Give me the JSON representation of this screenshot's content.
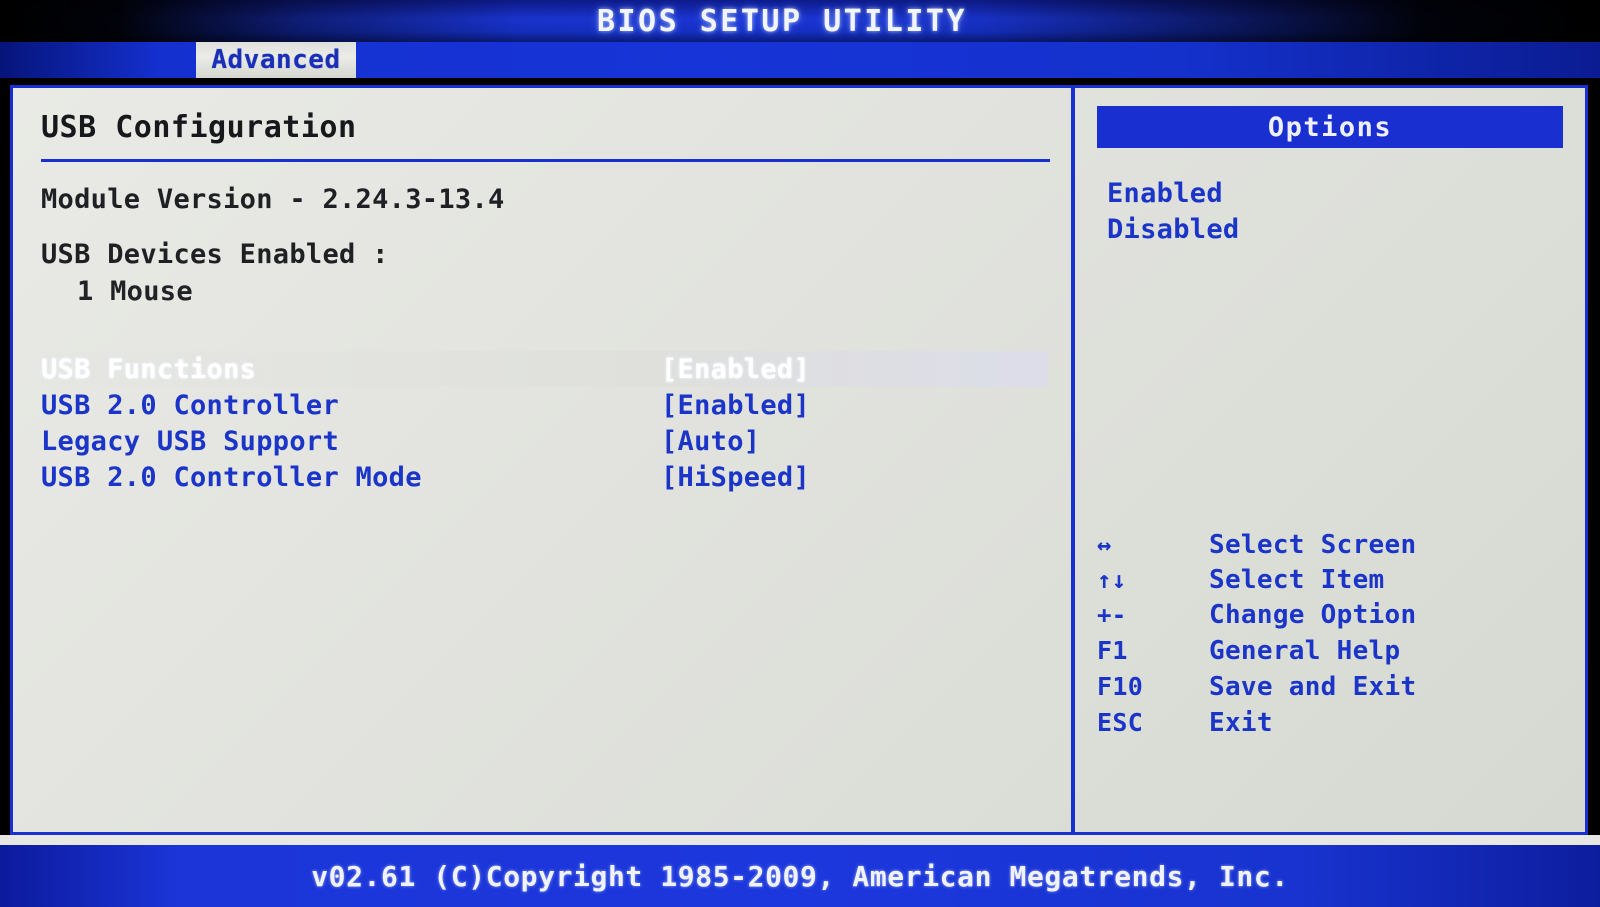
{
  "titlebar": {
    "title": "BIOS SETUP UTILITY"
  },
  "menubar": {
    "tabs": [
      {
        "label": "Advanced",
        "selected": true
      }
    ]
  },
  "main": {
    "section_title": "USB Configuration",
    "module_version_line": "Module Version - 2.24.3-13.4",
    "devices_header": "USB Devices Enabled :",
    "devices": [
      "1 Mouse"
    ],
    "settings": [
      {
        "label": "USB Functions",
        "value": "[Enabled]",
        "selected": true
      },
      {
        "label": "USB 2.0 Controller",
        "value": "[Enabled]",
        "selected": false
      },
      {
        "label": "Legacy USB Support",
        "value": "[Auto]",
        "selected": false
      },
      {
        "label": "USB 2.0 Controller Mode",
        "value": "[HiSpeed]",
        "selected": false
      }
    ]
  },
  "options_panel": {
    "header": "Options",
    "items": [
      "Enabled",
      "Disabled"
    ]
  },
  "legend": {
    "rows": [
      {
        "key": "↔",
        "desc": "Select Screen"
      },
      {
        "key": "↑↓",
        "desc": "Select Item"
      },
      {
        "key": "+-",
        "desc": "Change Option"
      },
      {
        "key": "F1",
        "desc": "General Help"
      },
      {
        "key": "F10",
        "desc": "Save and Exit"
      },
      {
        "key": "ESC",
        "desc": "Exit"
      }
    ]
  },
  "footer": {
    "copyright": "v02.61 (C)Copyright 1985-2009, American Megatrends, Inc."
  },
  "colors": {
    "accent_blue": "#1a2fd0",
    "text_blue": "#1b35c8",
    "panel_bg": "#e2e3de",
    "titlebar_blue": "#1b35d6",
    "heading_dark": "#16181c",
    "selected_text": "#ffffff"
  }
}
